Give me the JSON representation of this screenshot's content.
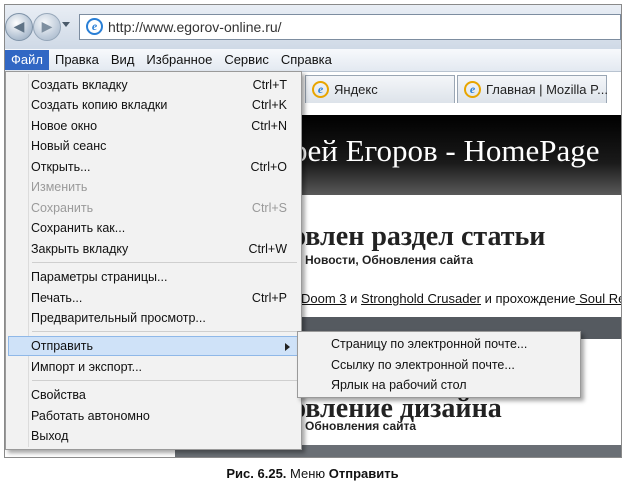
{
  "address_bar": {
    "url": "http://www.egorov-online.ru/"
  },
  "menubar": {
    "items": [
      "Файл",
      "Правка",
      "Вид",
      "Избранное",
      "Сервис",
      "Справка"
    ]
  },
  "tabs": [
    "Яндекс",
    "Главная | Mozilla P..."
  ],
  "page": {
    "banner": "рей Егоров - HomePage",
    "headline1": "овлен раздел статьи",
    "subline1": "Новости, Обновления сайта",
    "links_doom": "Doom 3",
    "links_and": " и ",
    "links_stronghold": "Stronghold Crusader",
    "links_walk": " и прохождение",
    "links_soul": " Soul Rea",
    "headline2": "овление дизайна",
    "subline2": "Обновления сайта"
  },
  "file_menu": {
    "items": [
      {
        "label": "Создать вкладку",
        "shortcut": "Ctrl+T"
      },
      {
        "label": "Создать копию вкладки",
        "shortcut": "Ctrl+K"
      },
      {
        "label": "Новое окно",
        "shortcut": "Ctrl+N"
      },
      {
        "label": "Новый сеанс",
        "shortcut": ""
      },
      {
        "label": "Открыть...",
        "shortcut": "Ctrl+O"
      },
      {
        "label": "Изменить",
        "shortcut": ""
      },
      {
        "label": "Сохранить",
        "shortcut": "Ctrl+S"
      },
      {
        "label": "Сохранить как...",
        "shortcut": ""
      },
      {
        "label": "Закрыть вкладку",
        "shortcut": "Ctrl+W"
      },
      {
        "label": "Параметры страницы...",
        "shortcut": ""
      },
      {
        "label": "Печать...",
        "shortcut": "Ctrl+P"
      },
      {
        "label": "Предварительный просмотр...",
        "shortcut": ""
      },
      {
        "label": "Отправить",
        "shortcut": ""
      },
      {
        "label": "Импорт и экспорт...",
        "shortcut": ""
      },
      {
        "label": "Свойства",
        "shortcut": ""
      },
      {
        "label": "Работать автономно",
        "shortcut": ""
      },
      {
        "label": "Выход",
        "shortcut": ""
      }
    ]
  },
  "send_menu": {
    "items": [
      "Страницу по электронной почте...",
      "Ссылку по электронной почте...",
      "Ярлык на рабочий стол"
    ]
  },
  "caption": {
    "figure": "Рис. 6.25.",
    "text": " Меню ",
    "menu_name": "Отправить"
  },
  "colors": {
    "menu_highlight": "#3167c4",
    "item_highlight": "#cfe2f8"
  }
}
